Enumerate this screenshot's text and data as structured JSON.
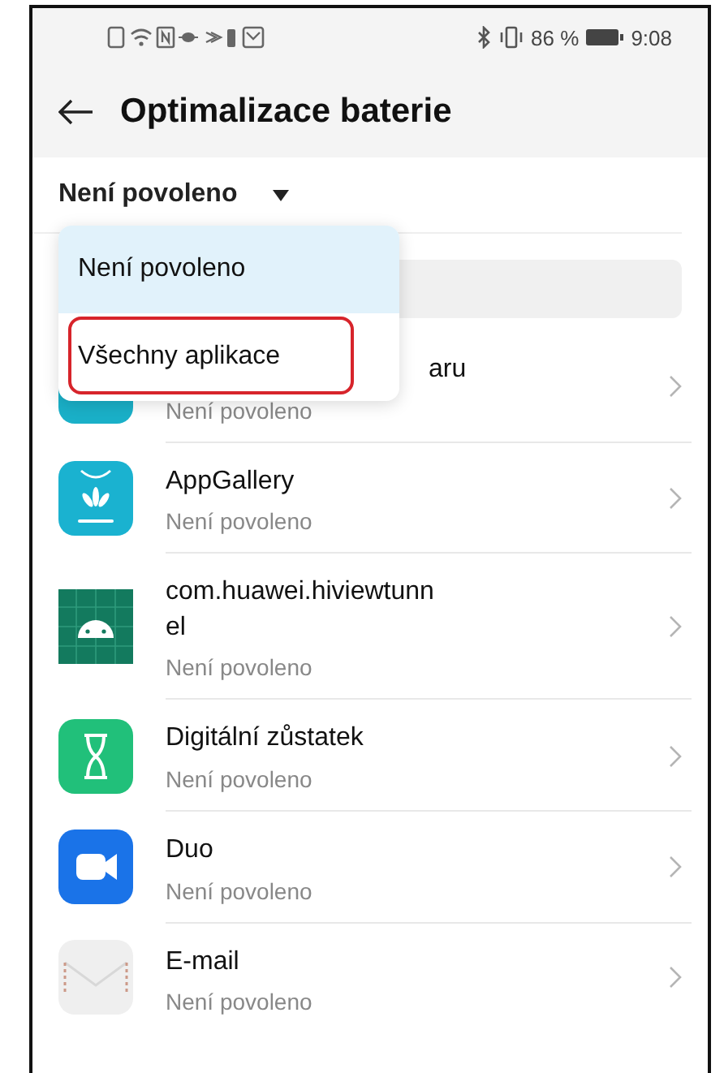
{
  "status_bar": {
    "battery_text": "86 %",
    "time": "9:08"
  },
  "header": {
    "title": "Optimalizace baterie"
  },
  "filter": {
    "label": "Není povoleno"
  },
  "dropdown": {
    "items": [
      {
        "label": "Není povoleno",
        "selected": true,
        "marked": false
      },
      {
        "label": "Všechny aplikace",
        "selected": false,
        "marked": true
      }
    ]
  },
  "apps": [
    {
      "name": "aru",
      "status": "Není povoleno",
      "kind": "teal"
    },
    {
      "name": "AppGallery",
      "status": "Není povoleno",
      "kind": "gallery"
    },
    {
      "name": "com.huawei.hiviewtunn\nel",
      "status": "Není povoleno",
      "kind": "android"
    },
    {
      "name": "Digitální zůstatek",
      "status": "Není povoleno",
      "kind": "wellbeing"
    },
    {
      "name": "Duo",
      "status": "Není povoleno",
      "kind": "video"
    },
    {
      "name": "E-mail",
      "status": "Není povoleno",
      "kind": "mail"
    }
  ]
}
